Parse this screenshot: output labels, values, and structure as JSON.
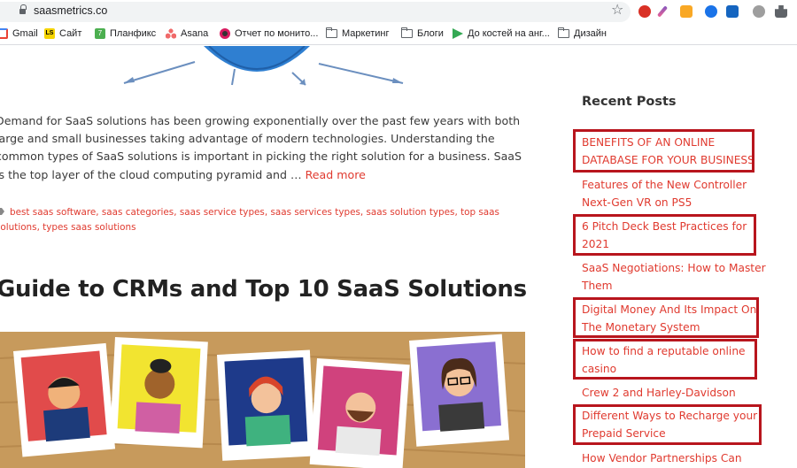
{
  "browser": {
    "url": "saasmetrics.co",
    "bookmarks": [
      {
        "label": "Gmail",
        "icon": "gmail-icon",
        "color": "#ea4335"
      },
      {
        "label": "Сайт",
        "icon": "ls-icon",
        "color": "#f5d400",
        "badge": "LS"
      },
      {
        "label": "Планфикс",
        "icon": "planfix-icon",
        "color": "#4caf50",
        "badge": "7"
      },
      {
        "label": "Asana",
        "icon": "asana-icon",
        "color": "#f06a6a"
      },
      {
        "label": "Отчет по монито...",
        "icon": "monitor-icon",
        "color": "#8e24aa"
      },
      {
        "label": "Маркетинг",
        "icon": "folder-icon"
      },
      {
        "label": "Блоги",
        "icon": "folder-icon"
      },
      {
        "label": "До костей на анг...",
        "icon": "play-icon",
        "color": "#34a853"
      },
      {
        "label": "Дизайн",
        "icon": "folder-icon"
      }
    ]
  },
  "article": {
    "excerpt": "Demand for SaaS solutions has been growing exponentially over the past few years with both large and small businesses taking advantage of modern technologies. Understanding the common types of SaaS solutions is important in picking the right solution for a business. SaaS is the top layer of the cloud computing pyramid and …",
    "read_more": "Read more",
    "tags": [
      "best saas software",
      "saas categories",
      "saas service types",
      "saas services types",
      "saas solution types",
      "top saas solutions",
      "types saas solutions"
    ],
    "next_title": "Guide to CRMs and Top 10 SaaS Solutions"
  },
  "sidebar": {
    "heading": "Recent Posts",
    "posts": [
      {
        "lines": [
          "BENEFITS OF AN ONLINE",
          "DATABASE FOR YOUR BUSINESS"
        ],
        "highlighted": true
      },
      {
        "lines": [
          "Features of the New Controller",
          "Next-Gen VR on PS5"
        ],
        "highlighted": false
      },
      {
        "lines": [
          "6 Pitch Deck Best Practices for",
          "2021"
        ],
        "highlighted": true
      },
      {
        "lines": [
          "SaaS Negotiations: How to Master",
          "Them"
        ],
        "highlighted": false
      },
      {
        "lines": [
          "Digital Money And Its Impact On",
          "The Monetary System"
        ],
        "highlighted": true
      },
      {
        "lines": [
          "How to find a reputable online",
          "casino"
        ],
        "highlighted": true
      },
      {
        "lines": [
          "Crew 2 and Harley-Davidson"
        ],
        "highlighted": false
      },
      {
        "lines": [
          "Different Ways to Recharge your",
          "Prepaid Service"
        ],
        "highlighted": true
      },
      {
        "lines": [
          "How Vendor Partnerships Can"
        ],
        "highlighted": false
      }
    ]
  },
  "colors": {
    "link": "#e03a2f",
    "highlight_box": "#b8151d",
    "board": "#c79a5c"
  }
}
